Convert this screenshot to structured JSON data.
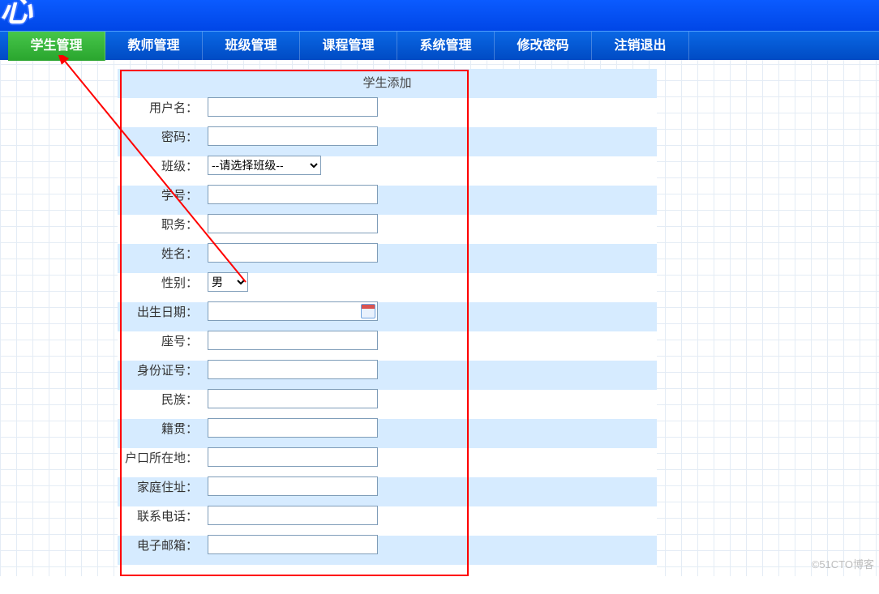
{
  "nav": {
    "items": [
      {
        "label": "学生管理",
        "active": true
      },
      {
        "label": "教师管理"
      },
      {
        "label": "班级管理"
      },
      {
        "label": "课程管理"
      },
      {
        "label": "系统管理"
      },
      {
        "label": "修改密码"
      },
      {
        "label": "注销退出"
      }
    ]
  },
  "form": {
    "title": "学生添加",
    "labels": {
      "username": "用户名：",
      "password": "密码：",
      "class": "班级：",
      "sid": "学号：",
      "duty": "职务：",
      "name": "姓名：",
      "gender": "性别：",
      "birth": "出生日期：",
      "seat": "座号：",
      "idcard": "身份证号：",
      "ethnic": "民族：",
      "native": "籍贯：",
      "hukou": "户口所在地：",
      "addr": "家庭住址：",
      "phone": "联系电话：",
      "email": "电子邮箱："
    },
    "class_placeholder": "--请选择班级--",
    "gender_value": "男"
  },
  "watermark": "©51CTO博客"
}
